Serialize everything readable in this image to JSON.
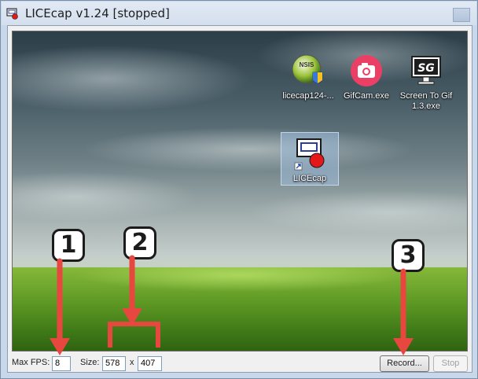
{
  "window": {
    "title": "LICEcap v1.24 [stopped]"
  },
  "desktop_icons": [
    {
      "label": "licecap124-...",
      "icon": "nsis-installer-icon"
    },
    {
      "label": "GifCam.exe",
      "icon": "camera-icon"
    },
    {
      "label": "Screen To Gif 1.3.exe",
      "icon": "monitor-sg-icon"
    },
    {
      "label": "LICEcap",
      "icon": "licecap-icon"
    }
  ],
  "nsis_badge": "NSIS",
  "sg_badge": "SG",
  "callouts": [
    "1",
    "2",
    "3"
  ],
  "controls": {
    "fps_label": "Max FPS:",
    "fps_value": "8",
    "size_label": "Size:",
    "width_value": "578",
    "x_label": "x",
    "height_value": "407",
    "record_label": "Record...",
    "stop_label": "Stop"
  },
  "colors": {
    "arrow": "#e8473f",
    "gifcam": "#ec3f66"
  }
}
